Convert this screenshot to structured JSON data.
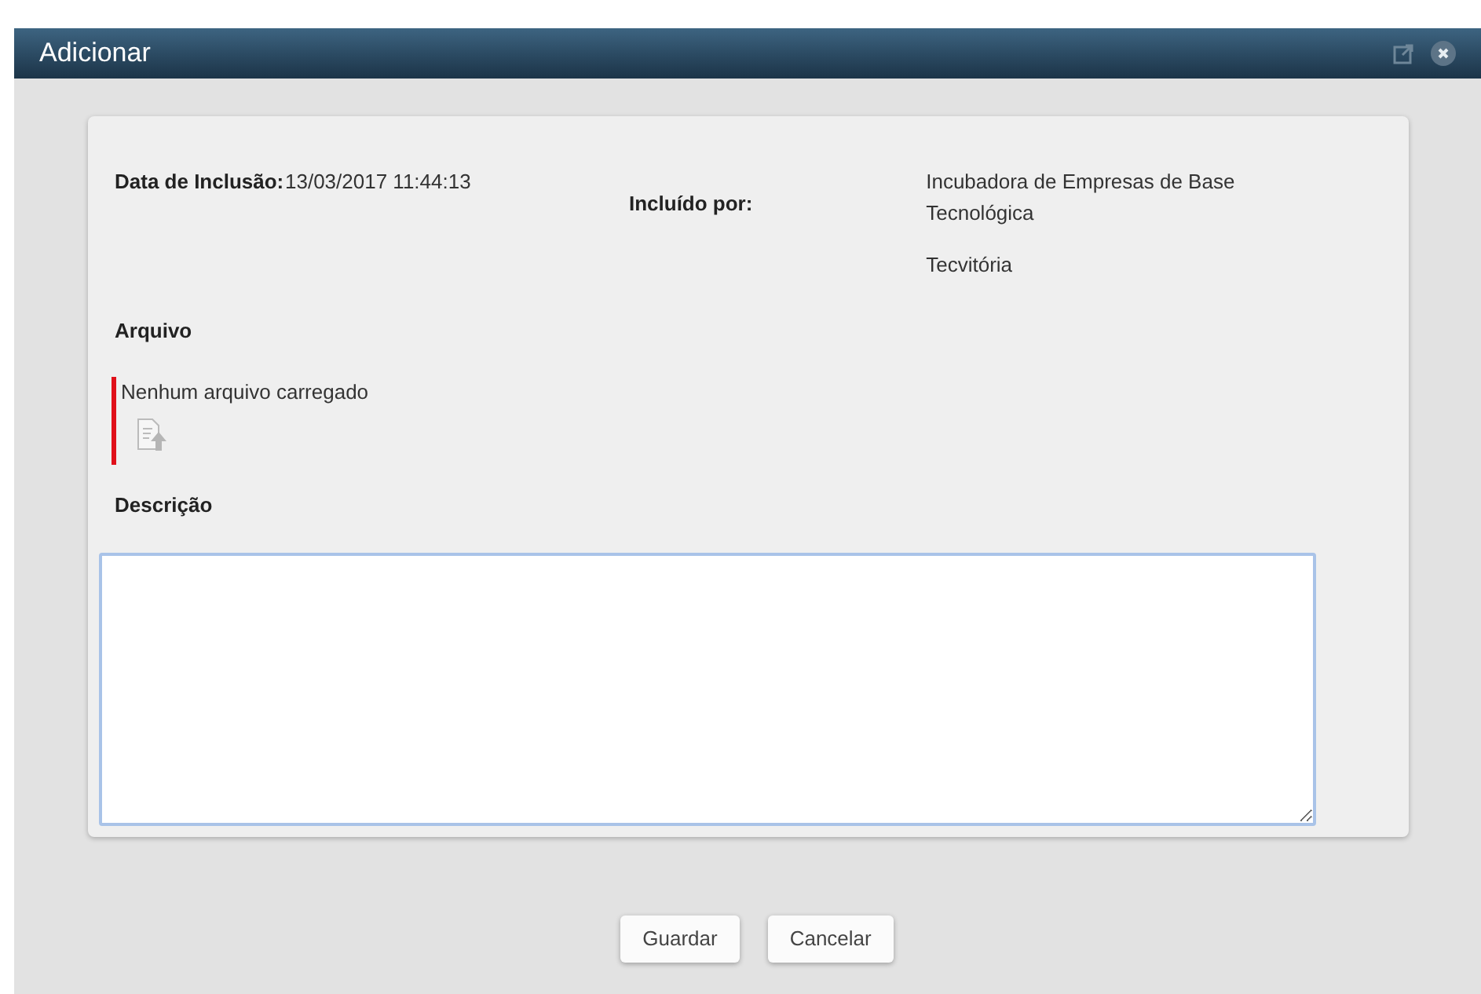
{
  "window": {
    "title": "Adicionar"
  },
  "fields": {
    "date_label": "Data de Inclusão:",
    "date_value": "13/03/2017 11:44:13",
    "by_label": "Incluído por:",
    "by_value_lines": [
      "Incubadora de Empresas de Base Tecnológica",
      "Tecvitória"
    ]
  },
  "file": {
    "label": "Arquivo",
    "status": "Nenhum arquivo carregado",
    "required": true
  },
  "description": {
    "label": "Descrição"
  },
  "buttons": [
    "Guardar",
    "Cancelar"
  ]
}
